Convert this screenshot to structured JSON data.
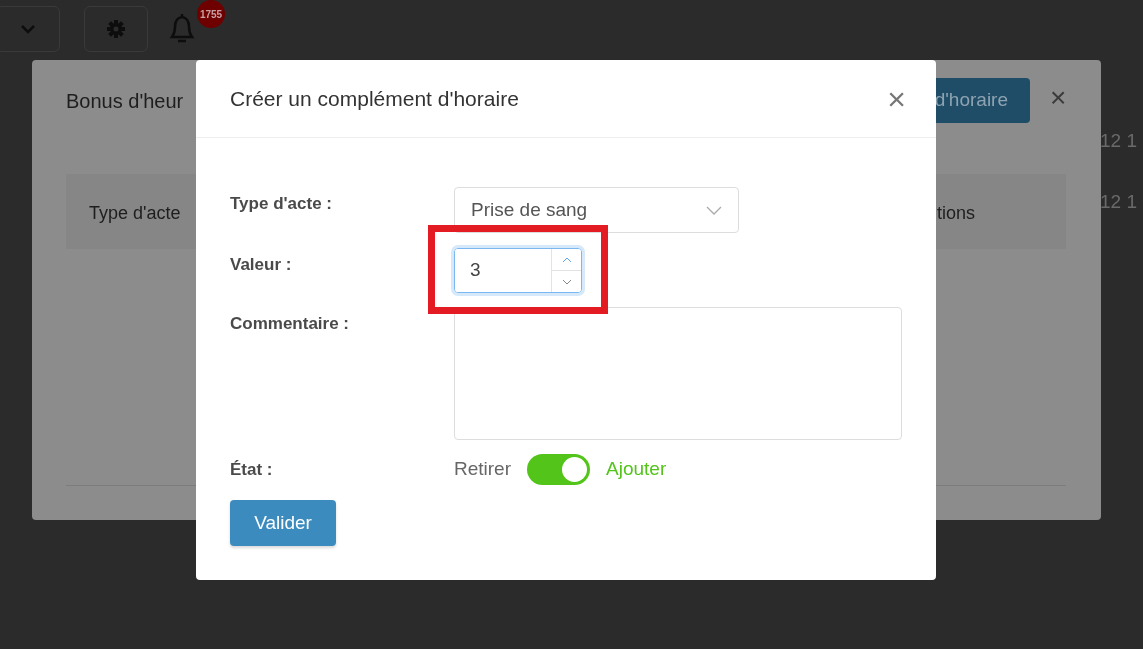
{
  "background": {
    "notification_count": "1755",
    "side_texts": [
      "12 1",
      "12 1"
    ]
  },
  "back_dialog": {
    "title": "Bonus d'heur",
    "button": "d'horaire",
    "close": "×",
    "columns": [
      "Type d'acte",
      "tions"
    ]
  },
  "dialog": {
    "title": "Créer un complément d'horaire",
    "close": "×",
    "fields": [
      {
        "kind": "select",
        "label": "Type d'acte :",
        "value": "Prise de sang"
      },
      {
        "kind": "number",
        "label": "Valeur :",
        "value": "3",
        "focused": true,
        "highlighted": true
      },
      {
        "kind": "textarea",
        "label": "Commentaire :"
      },
      {
        "kind": "toggle",
        "label": "État :",
        "off_label": "Retirer",
        "on_label": "Ajouter",
        "on": true
      }
    ],
    "submit": "Valider"
  }
}
